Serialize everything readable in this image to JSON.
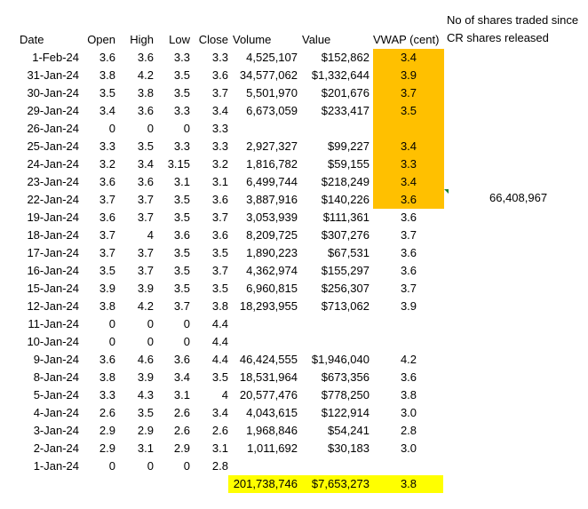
{
  "note": {
    "line1": "No of shares traded since",
    "line2": "CR shares released",
    "value": "66,408,967"
  },
  "headers": [
    "Date",
    "Open",
    "High",
    "Low",
    "Close",
    "Volume",
    "Value",
    "VWAP (cent)"
  ],
  "rows": [
    {
      "date": "1-Feb-24",
      "open": "3.6",
      "high": "3.6",
      "low": "3.3",
      "close": "3.3",
      "volume": "4,525,107",
      "value": "$152,862",
      "vwap": "3.4",
      "highlight": true
    },
    {
      "date": "31-Jan-24",
      "open": "3.8",
      "high": "4.2",
      "low": "3.5",
      "close": "3.6",
      "volume": "34,577,062",
      "value": "$1,332,644",
      "vwap": "3.9",
      "highlight": true
    },
    {
      "date": "30-Jan-24",
      "open": "3.5",
      "high": "3.8",
      "low": "3.5",
      "close": "3.7",
      "volume": "5,501,970",
      "value": "$201,676",
      "vwap": "3.7",
      "highlight": true
    },
    {
      "date": "29-Jan-24",
      "open": "3.4",
      "high": "3.6",
      "low": "3.3",
      "close": "3.4",
      "volume": "6,673,059",
      "value": "$233,417",
      "vwap": "3.5",
      "highlight": true
    },
    {
      "date": "26-Jan-24",
      "open": "0",
      "high": "0",
      "low": "0",
      "close": "3.3",
      "volume": "",
      "value": "",
      "vwap": "",
      "highlight": true
    },
    {
      "date": "25-Jan-24",
      "open": "3.3",
      "high": "3.5",
      "low": "3.3",
      "close": "3.3",
      "volume": "2,927,327",
      "value": "$99,227",
      "vwap": "3.4",
      "highlight": true
    },
    {
      "date": "24-Jan-24",
      "open": "3.2",
      "high": "3.4",
      "low": "3.15",
      "close": "3.2",
      "volume": "1,816,782",
      "value": "$59,155",
      "vwap": "3.3",
      "highlight": true
    },
    {
      "date": "23-Jan-24",
      "open": "3.6",
      "high": "3.6",
      "low": "3.1",
      "close": "3.1",
      "volume": "6,499,744",
      "value": "$218,249",
      "vwap": "3.4",
      "highlight": true
    },
    {
      "date": "22-Jan-24",
      "open": "3.7",
      "high": "3.7",
      "low": "3.5",
      "close": "3.6",
      "volume": "3,887,916",
      "value": "$140,226",
      "vwap": "3.6",
      "highlight": true
    },
    {
      "date": "19-Jan-24",
      "open": "3.6",
      "high": "3.7",
      "low": "3.5",
      "close": "3.7",
      "volume": "3,053,939",
      "value": "$111,361",
      "vwap": "3.6",
      "highlight": false
    },
    {
      "date": "18-Jan-24",
      "open": "3.7",
      "high": "4",
      "low": "3.6",
      "close": "3.6",
      "volume": "8,209,725",
      "value": "$307,276",
      "vwap": "3.7",
      "highlight": false
    },
    {
      "date": "17-Jan-24",
      "open": "3.7",
      "high": "3.7",
      "low": "3.5",
      "close": "3.5",
      "volume": "1,890,223",
      "value": "$67,531",
      "vwap": "3.6",
      "highlight": false
    },
    {
      "date": "16-Jan-24",
      "open": "3.5",
      "high": "3.7",
      "low": "3.5",
      "close": "3.7",
      "volume": "4,362,974",
      "value": "$155,297",
      "vwap": "3.6",
      "highlight": false
    },
    {
      "date": "15-Jan-24",
      "open": "3.9",
      "high": "3.9",
      "low": "3.5",
      "close": "3.5",
      "volume": "6,960,815",
      "value": "$256,307",
      "vwap": "3.7",
      "highlight": false
    },
    {
      "date": "12-Jan-24",
      "open": "3.8",
      "high": "4.2",
      "low": "3.7",
      "close": "3.8",
      "volume": "18,293,955",
      "value": "$713,062",
      "vwap": "3.9",
      "highlight": false
    },
    {
      "date": "11-Jan-24",
      "open": "0",
      "high": "0",
      "low": "0",
      "close": "4.4",
      "volume": "",
      "value": "",
      "vwap": "",
      "highlight": false
    },
    {
      "date": "10-Jan-24",
      "open": "0",
      "high": "0",
      "low": "0",
      "close": "4.4",
      "volume": "",
      "value": "",
      "vwap": "",
      "highlight": false
    },
    {
      "date": "9-Jan-24",
      "open": "3.6",
      "high": "4.6",
      "low": "3.6",
      "close": "4.4",
      "volume": "46,424,555",
      "value": "$1,946,040",
      "vwap": "4.2",
      "highlight": false
    },
    {
      "date": "8-Jan-24",
      "open": "3.8",
      "high": "3.9",
      "low": "3.4",
      "close": "3.5",
      "volume": "18,531,964",
      "value": "$673,356",
      "vwap": "3.6",
      "highlight": false
    },
    {
      "date": "5-Jan-24",
      "open": "3.3",
      "high": "4.3",
      "low": "3.1",
      "close": "4",
      "volume": "20,577,476",
      "value": "$778,250",
      "vwap": "3.8",
      "highlight": false
    },
    {
      "date": "4-Jan-24",
      "open": "2.6",
      "high": "3.5",
      "low": "2.6",
      "close": "3.4",
      "volume": "4,043,615",
      "value": "$122,914",
      "vwap": "3.0",
      "highlight": false
    },
    {
      "date": "3-Jan-24",
      "open": "2.9",
      "high": "2.9",
      "low": "2.6",
      "close": "2.6",
      "volume": "1,968,846",
      "value": "$54,241",
      "vwap": "2.8",
      "highlight": false
    },
    {
      "date": "2-Jan-24",
      "open": "2.9",
      "high": "3.1",
      "low": "2.9",
      "close": "3.1",
      "volume": "1,011,692",
      "value": "$30,183",
      "vwap": "3.0",
      "highlight": false
    },
    {
      "date": "1-Jan-24",
      "open": "0",
      "high": "0",
      "low": "0",
      "close": "2.8",
      "volume": "",
      "value": "",
      "vwap": "",
      "highlight": false
    }
  ],
  "totals": {
    "volume": "201,738,746",
    "value": "$7,653,273",
    "vwap": "3.8"
  },
  "colors": {
    "orange": "#FFC000",
    "yellow": "#FFFF00",
    "comment_marker": "#1a7f37"
  }
}
